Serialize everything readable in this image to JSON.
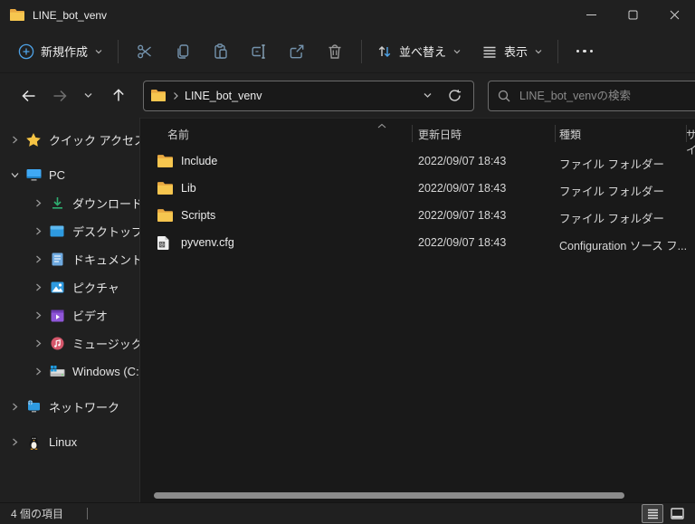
{
  "window": {
    "title": "LINE_bot_venv"
  },
  "toolbar": {
    "new": "新規作成",
    "sort": "並べ替え",
    "view": "表示"
  },
  "navbar": {
    "path": "LINE_bot_venv",
    "search_placeholder": "LINE_bot_venvの検索"
  },
  "sidebar": {
    "items": [
      {
        "label": "クイック アクセス",
        "icon": "star"
      },
      {
        "label": "PC",
        "icon": "monitor"
      },
      {
        "label": "ダウンロード",
        "icon": "download"
      },
      {
        "label": "デスクトップ",
        "icon": "desktop"
      },
      {
        "label": "ドキュメント",
        "icon": "document"
      },
      {
        "label": "ピクチャ",
        "icon": "pictures"
      },
      {
        "label": "ビデオ",
        "icon": "videos"
      },
      {
        "label": "ミュージック",
        "icon": "music"
      },
      {
        "label": "Windows (C:)",
        "icon": "drive"
      },
      {
        "label": "ネットワーク",
        "icon": "network"
      },
      {
        "label": "Linux",
        "icon": "linux"
      }
    ]
  },
  "filelist": {
    "columns": {
      "name": "名前",
      "date": "更新日時",
      "type": "種類",
      "size": "サイ"
    },
    "rows": [
      {
        "name": "Include",
        "date": "2022/09/07 18:43",
        "type": "ファイル フォルダー",
        "icon": "folder"
      },
      {
        "name": "Lib",
        "date": "2022/09/07 18:43",
        "type": "ファイル フォルダー",
        "icon": "folder"
      },
      {
        "name": "Scripts",
        "date": "2022/09/07 18:43",
        "type": "ファイル フォルダー",
        "icon": "folder"
      },
      {
        "name": "pyvenv.cfg",
        "date": "2022/09/07 18:43",
        "type": "Configuration ソース フ...",
        "icon": "config-file"
      }
    ]
  },
  "statusbar": {
    "count": "4 個の項目"
  },
  "colors": {
    "accent_blue": "#4ea3e8",
    "toolbar_icon_steel": "#7493ad",
    "folder_yellow": "#f6c64f",
    "window_bg": "#202020",
    "content_bg": "#191919"
  }
}
